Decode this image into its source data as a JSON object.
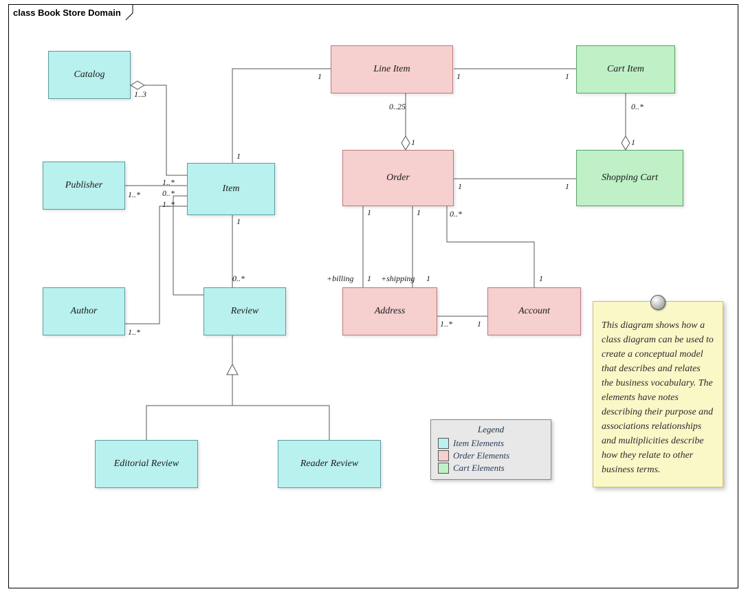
{
  "frame": {
    "title": "class Book Store Domain"
  },
  "classes": {
    "catalog": {
      "label": "Catalog",
      "category": "item"
    },
    "publisher": {
      "label": "Publisher",
      "category": "item"
    },
    "author": {
      "label": "Author",
      "category": "item"
    },
    "item": {
      "label": "Item",
      "category": "item"
    },
    "review": {
      "label": "Review",
      "category": "item"
    },
    "editorialReview": {
      "label": "Editorial Review",
      "category": "item"
    },
    "readerReview": {
      "label": "Reader Review",
      "category": "item"
    },
    "lineItem": {
      "label": "Line Item",
      "category": "order"
    },
    "order": {
      "label": "Order",
      "category": "order"
    },
    "address": {
      "label": "Address",
      "category": "order"
    },
    "account": {
      "label": "Account",
      "category": "order"
    },
    "cartItem": {
      "label": "Cart Item",
      "category": "cart"
    },
    "shoppingCart": {
      "label": "Shopping Cart",
      "category": "cart"
    }
  },
  "associations": [
    {
      "from": "catalog",
      "to": "item",
      "type": "aggregation",
      "fromMult": null,
      "toMult": "1..3"
    },
    {
      "from": "publisher",
      "to": "item",
      "type": "association",
      "fromMult": "1..*",
      "toMult": "1..*"
    },
    {
      "from": "item",
      "to": "review",
      "type": "association",
      "fromMult": "0..*",
      "toMult": null
    },
    {
      "from": "author",
      "to": "item",
      "type": "association",
      "fromMult": "1..*",
      "toMult": "1..*"
    },
    {
      "from": "item",
      "to": "review",
      "type": "association",
      "fromMult": "1",
      "toMult": "0..*"
    },
    {
      "from": "item",
      "to": "lineItem",
      "type": "association",
      "fromMult": "1",
      "toMult": "1"
    },
    {
      "from": "order",
      "to": "lineItem",
      "type": "aggregation",
      "fromMult": "1",
      "toMult": "0..25"
    },
    {
      "from": "lineItem",
      "to": "cartItem",
      "type": "association",
      "fromMult": "1",
      "toMult": "1"
    },
    {
      "from": "shoppingCart",
      "to": "cartItem",
      "type": "aggregation",
      "fromMult": "1",
      "toMult": "0..*"
    },
    {
      "from": "order",
      "to": "shoppingCart",
      "type": "association",
      "fromMult": "1",
      "toMult": "1"
    },
    {
      "from": "order",
      "to": "address",
      "type": "association",
      "fromMult": "1",
      "toMult": "1",
      "fromRole": "+billing"
    },
    {
      "from": "order",
      "to": "address",
      "type": "association",
      "fromMult": "1",
      "toMult": "1",
      "fromRole": "+shipping"
    },
    {
      "from": "order",
      "to": "account",
      "type": "association",
      "fromMult": "0..*",
      "toMult": "1"
    },
    {
      "from": "account",
      "to": "address",
      "type": "association",
      "fromMult": "1",
      "toMult": "1..*"
    },
    {
      "from": "editorialReview",
      "to": "review",
      "type": "generalization"
    },
    {
      "from": "readerReview",
      "to": "review",
      "type": "generalization"
    }
  ],
  "legend": {
    "title": "Legend",
    "items": [
      {
        "label": "Item Elements",
        "category": "item"
      },
      {
        "label": "Order Elements",
        "category": "order"
      },
      {
        "label": "Cart Elements",
        "category": "cart"
      }
    ]
  },
  "note": {
    "text": "This diagram shows how a class diagram can be used to create a conceptual model that describes and relates the business vocabulary. The elements have notes describing their purpose and associations relationships and multiplicities describe how they relate to other business terms."
  },
  "colors": {
    "item": "#b9f1ee",
    "order": "#f6cfcf",
    "cart": "#bff0c6"
  }
}
